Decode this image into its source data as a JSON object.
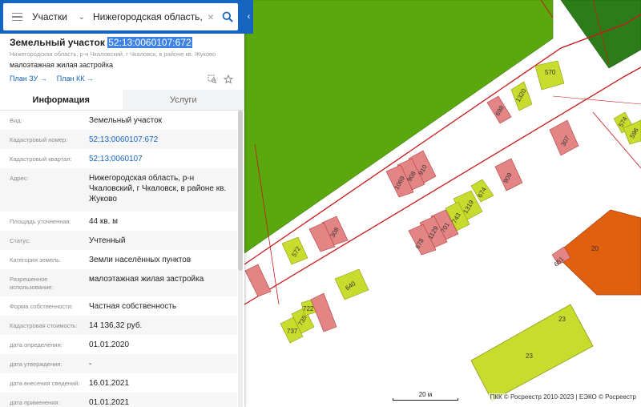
{
  "search": {
    "layer": "Участки",
    "query": "Нижегородская область, р-н Чкаловский"
  },
  "object": {
    "type_title": "Земельный участок",
    "cadastral_number": "52:13:0060107:672",
    "address_short": "Нижегородская область, р-н Чкаловский, г Чкаловск, в районе кв. Жуково",
    "use": "малоэтажная жилая застройка",
    "link_plan_zu": "План ЗУ →",
    "link_plan_kk": "План КК →"
  },
  "tabs": [
    {
      "label": "Информация",
      "active": true
    },
    {
      "label": "Услуги",
      "active": false
    }
  ],
  "info_rows": [
    {
      "label": "Вид:",
      "value": "Земельный участок"
    },
    {
      "label": "Кадастровый номер:",
      "value": "52:13:0060107:672"
    },
    {
      "label": "Кадастровый квартал:",
      "value": "52:13:0060107"
    },
    {
      "label": "Адрес:",
      "value": "Нижегородская область, р-н Чкаловский, г Чкаловск, в районе кв. Жуково"
    },
    {
      "label": "Площадь уточненная:",
      "value": "44 кв. м"
    },
    {
      "label": "Статус:",
      "value": "Учтенный"
    },
    {
      "label": "Категория земель:",
      "value": "Земли населённых пунктов"
    },
    {
      "label": "Разрешенное использование:",
      "value": "малоэтажная жилая застройка"
    },
    {
      "label": "Форма собственности:",
      "value": "Частная собственность"
    },
    {
      "label": "Кадастровая стоимость:",
      "value": "14 136,32 руб."
    },
    {
      "label": "дата определения:",
      "value": "01.01.2020"
    },
    {
      "label": "дата утверждения:",
      "value": "-"
    },
    {
      "label": "дата внесения сведений:",
      "value": "16.01.2021"
    },
    {
      "label": "дата применения:",
      "value": "01.01.2021"
    }
  ],
  "map": {
    "parcel_labels": [
      "570",
      "1320",
      "698",
      "307",
      "574",
      "596",
      "910",
      "908",
      "1069",
      "743",
      "1319",
      "674",
      "701",
      "1129",
      "572",
      "308",
      "651",
      "20",
      "640",
      "678",
      "722",
      "735",
      "737",
      "23",
      "23",
      "909"
    ],
    "scale_label": "20 м",
    "copyright": "ПКК © Росреестр 2010-2023 | ЕЭКО © Росреестр"
  },
  "colors": {
    "accent": "#1565c0",
    "highlight": "#3d83e6",
    "green_zone": "#5aa80e",
    "dark_green_zone": "#2c7d1a",
    "parcel_yellow": "#c8dc2e",
    "parcel_pink": "#e38585",
    "parcel_orange": "#e06010",
    "boundary_red": "#c8161a"
  }
}
